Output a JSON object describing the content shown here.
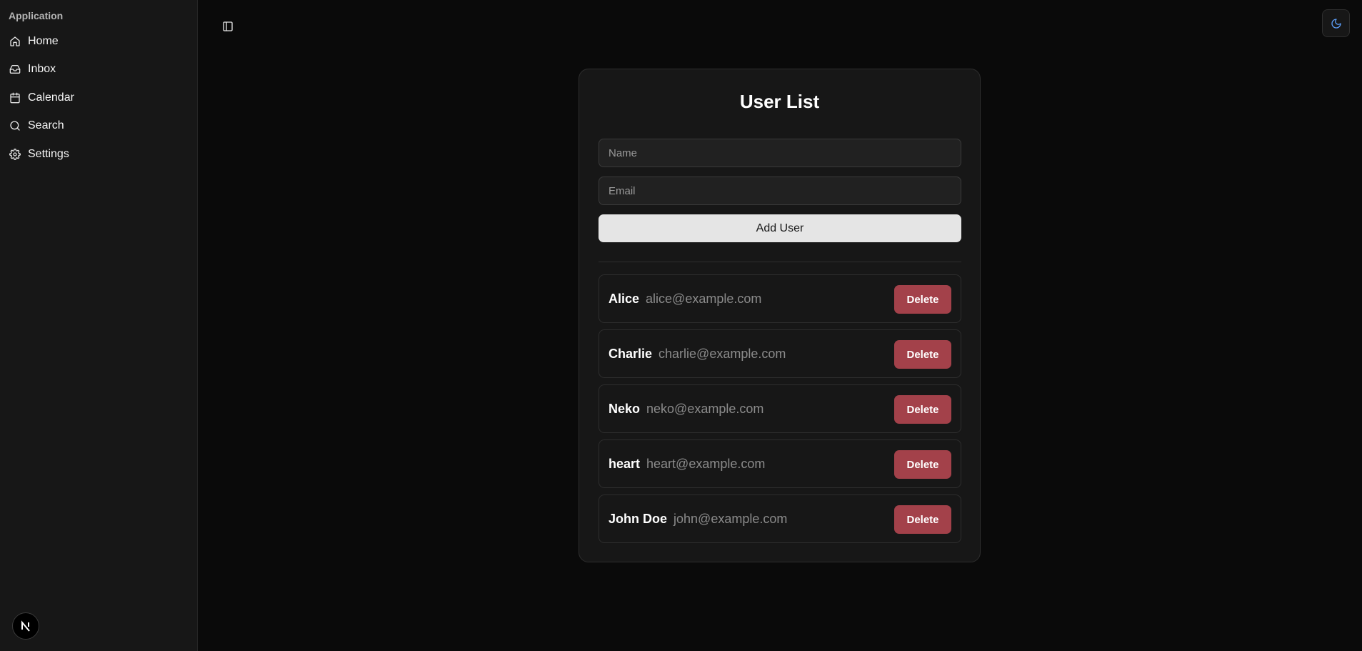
{
  "sidebar": {
    "group_label": "Application",
    "items": [
      {
        "label": "Home",
        "icon": "home-icon"
      },
      {
        "label": "Inbox",
        "icon": "inbox-icon"
      },
      {
        "label": "Calendar",
        "icon": "calendar-icon"
      },
      {
        "label": "Search",
        "icon": "search-icon"
      },
      {
        "label": "Settings",
        "icon": "settings-icon"
      }
    ],
    "badge_letter": "N"
  },
  "header": {
    "sidebar_toggle_icon": "panel-left-icon",
    "theme_toggle_icon": "moon-icon",
    "theme_icon_color": "#5b9cf5"
  },
  "card": {
    "title": "User List",
    "name_placeholder": "Name",
    "email_placeholder": "Email",
    "add_button_label": "Add User",
    "users": [
      {
        "name": "Alice",
        "email": "alice@example.com",
        "delete_label": "Delete"
      },
      {
        "name": "Charlie",
        "email": "charlie@example.com",
        "delete_label": "Delete"
      },
      {
        "name": "Neko",
        "email": "neko@example.com",
        "delete_label": "Delete"
      },
      {
        "name": "heart",
        "email": "heart@example.com",
        "delete_label": "Delete"
      },
      {
        "name": "John Doe",
        "email": "john@example.com",
        "delete_label": "Delete"
      }
    ]
  },
  "colors": {
    "background": "#0a0a0a",
    "sidebar": "#171717",
    "card": "#171717",
    "delete_button": "#a3414a",
    "add_button": "#e5e5e5"
  }
}
